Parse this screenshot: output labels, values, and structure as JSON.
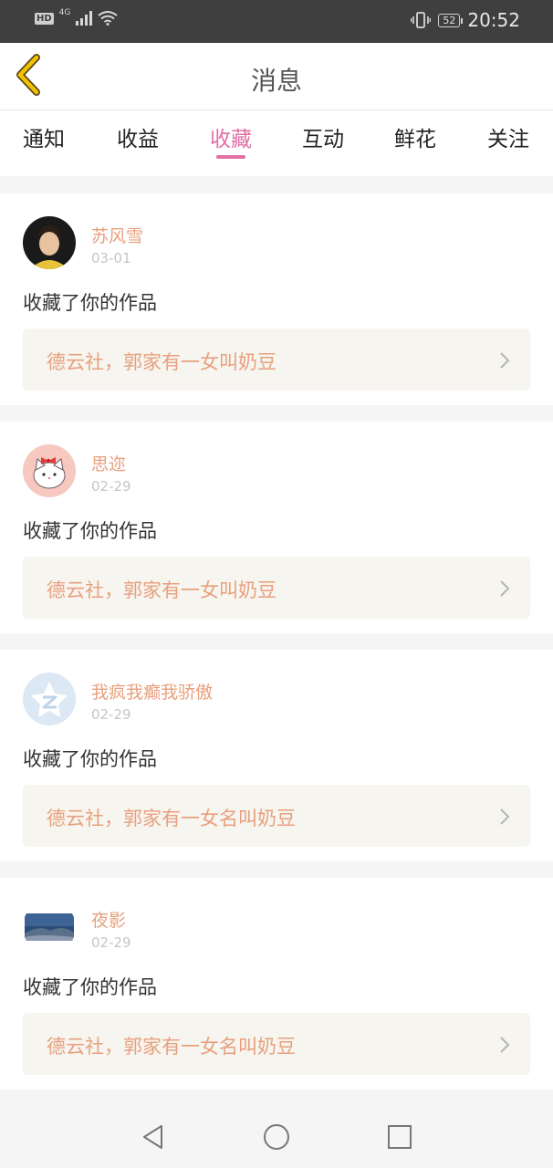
{
  "status_bar": {
    "hd": "HD",
    "network": "4G",
    "battery": "52",
    "time": "20:52"
  },
  "header": {
    "title": "消息",
    "back_icon": "chevron-left-icon"
  },
  "tabs": [
    {
      "label": "通知"
    },
    {
      "label": "收益"
    },
    {
      "label": "收藏",
      "active": true
    },
    {
      "label": "互动"
    },
    {
      "label": "鲜花"
    },
    {
      "label": "关注"
    }
  ],
  "notifications": [
    {
      "user": "苏风雪",
      "date": "03-01",
      "action": "收藏了你的作品",
      "work": "德云社，郭家有一女叫奶豆"
    },
    {
      "user": "思迩",
      "date": "02-29",
      "action": "收藏了你的作品",
      "work": "德云社，郭家有一女叫奶豆"
    },
    {
      "user": "我疯我癫我骄傲",
      "date": "02-29",
      "action": "收藏了你的作品",
      "work": "德云社，郭家有一女名叫奶豆"
    },
    {
      "user": "夜影",
      "date": "02-29",
      "action": "收藏了你的作品",
      "work": "德云社，郭家有一女名叫奶豆"
    }
  ],
  "colors": {
    "accent_pink": "#e26fa6",
    "name_orange": "#e8a07e",
    "link_bg": "#f6f5ef",
    "back_yellow": "#f2c200"
  }
}
